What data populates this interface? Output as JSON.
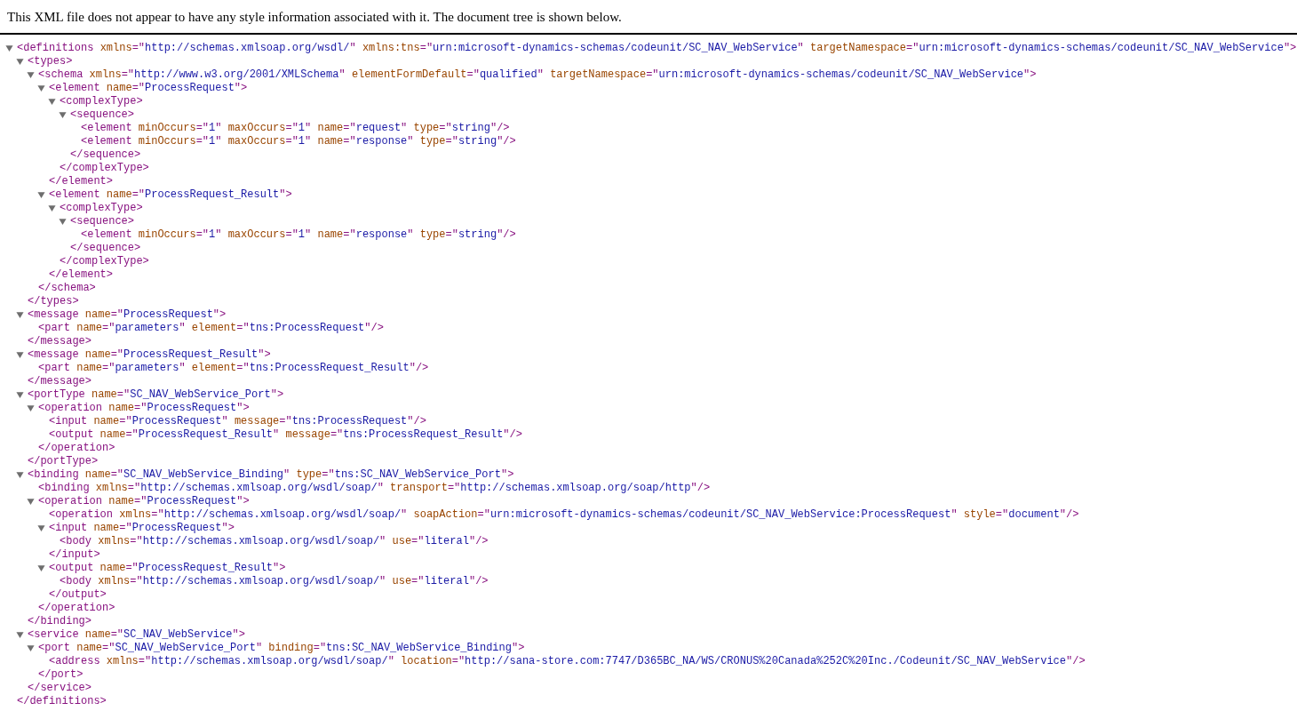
{
  "notice": "This XML file does not appear to have any style information associated with it. The document tree is shown below.",
  "tree": {
    "open": "<definitions xmlns=\"http://schemas.xmlsoap.org/wsdl/\" xmlns:tns=\"urn:microsoft-dynamics-schemas/codeunit/SC_NAV_WebService\" targetNamespace=\"urn:microsoft-dynamics-schemas/codeunit/SC_NAV_WebService\">",
    "expanded": true,
    "close": "</definitions>",
    "children": [
      {
        "open": "<types>",
        "expanded": true,
        "close": "</types>",
        "children": [
          {
            "open": "<schema xmlns=\"http://www.w3.org/2001/XMLSchema\" elementFormDefault=\"qualified\" targetNamespace=\"urn:microsoft-dynamics-schemas/codeunit/SC_NAV_WebService\">",
            "expanded": true,
            "close": "</schema>",
            "children": [
              {
                "open": "<element name=\"ProcessRequest\">",
                "expanded": true,
                "close": "</element>",
                "children": [
                  {
                    "open": "<complexType>",
                    "expanded": true,
                    "close": "</complexType>",
                    "children": [
                      {
                        "open": "<sequence>",
                        "expanded": true,
                        "close": "</sequence>",
                        "children": [
                          {
                            "open": "<element minOccurs=\"1\" maxOccurs=\"1\" name=\"request\" type=\"string\"/>"
                          },
                          {
                            "open": "<element minOccurs=\"1\" maxOccurs=\"1\" name=\"response\" type=\"string\"/>"
                          }
                        ]
                      }
                    ]
                  }
                ]
              },
              {
                "open": "<element name=\"ProcessRequest_Result\">",
                "expanded": true,
                "close": "</element>",
                "children": [
                  {
                    "open": "<complexType>",
                    "expanded": true,
                    "close": "</complexType>",
                    "children": [
                      {
                        "open": "<sequence>",
                        "expanded": true,
                        "close": "</sequence>",
                        "children": [
                          {
                            "open": "<element minOccurs=\"1\" maxOccurs=\"1\" name=\"response\" type=\"string\"/>"
                          }
                        ]
                      }
                    ]
                  }
                ]
              }
            ]
          }
        ]
      },
      {
        "open": "<message name=\"ProcessRequest\">",
        "expanded": true,
        "close": "</message>",
        "children": [
          {
            "open": "<part name=\"parameters\" element=\"tns:ProcessRequest\"/>"
          }
        ]
      },
      {
        "open": "<message name=\"ProcessRequest_Result\">",
        "expanded": true,
        "close": "</message>",
        "children": [
          {
            "open": "<part name=\"parameters\" element=\"tns:ProcessRequest_Result\"/>"
          }
        ]
      },
      {
        "open": "<portType name=\"SC_NAV_WebService_Port\">",
        "expanded": true,
        "close": "</portType>",
        "children": [
          {
            "open": "<operation name=\"ProcessRequest\">",
            "expanded": true,
            "close": "</operation>",
            "children": [
              {
                "open": "<input name=\"ProcessRequest\" message=\"tns:ProcessRequest\"/>"
              },
              {
                "open": "<output name=\"ProcessRequest_Result\" message=\"tns:ProcessRequest_Result\"/>"
              }
            ]
          }
        ]
      },
      {
        "open": "<binding name=\"SC_NAV_WebService_Binding\" type=\"tns:SC_NAV_WebService_Port\">",
        "expanded": true,
        "close": "</binding>",
        "children": [
          {
            "open": "<binding xmlns=\"http://schemas.xmlsoap.org/wsdl/soap/\" transport=\"http://schemas.xmlsoap.org/soap/http\"/>"
          },
          {
            "open": "<operation name=\"ProcessRequest\">",
            "expanded": true,
            "close": "</operation>",
            "children": [
              {
                "open": "<operation xmlns=\"http://schemas.xmlsoap.org/wsdl/soap/\" soapAction=\"urn:microsoft-dynamics-schemas/codeunit/SC_NAV_WebService:ProcessRequest\" style=\"document\"/>"
              },
              {
                "open": "<input name=\"ProcessRequest\">",
                "expanded": true,
                "close": "</input>",
                "children": [
                  {
                    "open": "<body xmlns=\"http://schemas.xmlsoap.org/wsdl/soap/\" use=\"literal\"/>"
                  }
                ]
              },
              {
                "open": "<output name=\"ProcessRequest_Result\">",
                "expanded": true,
                "close": "</output>",
                "children": [
                  {
                    "open": "<body xmlns=\"http://schemas.xmlsoap.org/wsdl/soap/\" use=\"literal\"/>"
                  }
                ]
              }
            ]
          }
        ]
      },
      {
        "open": "<service name=\"SC_NAV_WebService\">",
        "expanded": true,
        "close": "</service>",
        "children": [
          {
            "open": "<port name=\"SC_NAV_WebService_Port\" binding=\"tns:SC_NAV_WebService_Binding\">",
            "expanded": true,
            "close": "</port>",
            "children": [
              {
                "open": "<address xmlns=\"http://schemas.xmlsoap.org/wsdl/soap/\" location=\"http://sana-store.com:7747/D365BC_NA/WS/CRONUS%20Canada%252C%20Inc./Codeunit/SC_NAV_WebService\"/>"
              }
            ]
          }
        ]
      }
    ]
  }
}
